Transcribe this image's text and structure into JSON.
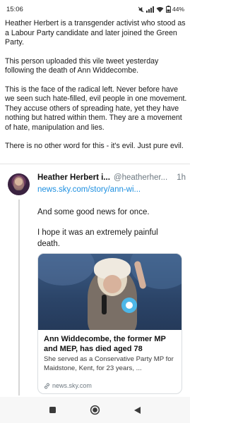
{
  "status_bar": {
    "time": "15:06",
    "battery": "44%"
  },
  "post": {
    "paragraphs": [
      "Heather Herbert is a transgender activist who stood as a Labour Party candidate and later joined the Green Party.",
      "This person uploaded this vile tweet yesterday following the death of Ann Widdecombe.",
      "This is the face of the radical left. Never before have we seen such hate-filled, evil people in one movement. They accuse others of spreading hate, yet they have nothing but hatred within them. They are a movement of hate, manipulation and lies.",
      "There is no other word for this - it's evil. Just pure evil."
    ]
  },
  "embedded_tweet": {
    "name": "Heather Herbert i...",
    "handle": "@heatherher...",
    "time": "1h",
    "link": "news.sky.com/story/ann-wi...",
    "body": [
      "And some good news for once.",
      "I hope it was an extremely painful death."
    ],
    "card": {
      "title": "Ann Widdecombe, the former MP and MEP, has died aged 78",
      "description": "She served as a Conservative Party MP for Maidstone, Kent, for 23 years, ...",
      "domain": "news.sky.com"
    }
  },
  "colors": {
    "link": "#1d8fe0",
    "muted": "#6d7880"
  },
  "icons": [
    "signal-icon",
    "wifi-icon",
    "battery-icon",
    "recents-icon",
    "home-icon",
    "back-icon",
    "link-icon"
  ]
}
